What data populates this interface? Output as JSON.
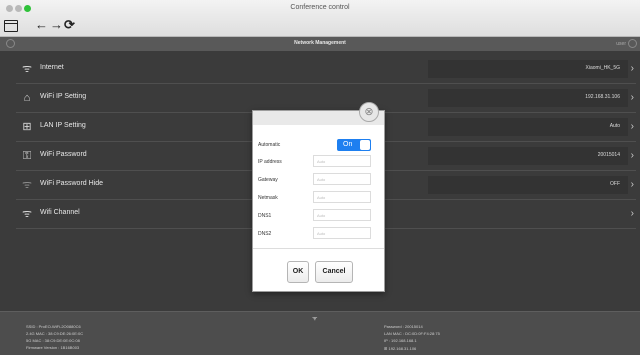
{
  "window": {
    "title": "Conference control"
  },
  "toolbar": {
    "window_icon": "window-icon",
    "back": "←",
    "forward": "→",
    "reload": "⟳"
  },
  "header": {
    "title": "Network Management",
    "user": "user"
  },
  "rows": [
    {
      "label": "Internet",
      "value": "Xiaomi_HK_5G",
      "icon": "wifi-icon",
      "glyph": "ᯤ"
    },
    {
      "label": "WiFi IP Setting",
      "value": "192.168.31.106",
      "icon": "router-icon",
      "glyph": "⌂"
    },
    {
      "label": "LAN IP Setting",
      "value": "Auto",
      "icon": "lan-icon",
      "glyph": "⊞"
    },
    {
      "label": "WiFi Password",
      "value": "20015014",
      "icon": "password-icon",
      "glyph": "⚿"
    },
    {
      "label": "WiFi Password Hide",
      "value": "OFF",
      "icon": "wifi-hide-icon",
      "glyph": "ᯤ"
    },
    {
      "label": "Wifi Channel",
      "value": "",
      "icon": "wifi-channel-icon",
      "glyph": "ᯤ"
    }
  ],
  "modal": {
    "automatic_label": "Automatic",
    "toggle_label": "On",
    "fields": [
      {
        "label": "IP address",
        "placeholder": "Auto"
      },
      {
        "label": "Gateway",
        "placeholder": "Auto"
      },
      {
        "label": "Netmask",
        "placeholder": "Auto"
      },
      {
        "label": "DNS1",
        "placeholder": "Auto"
      },
      {
        "label": "DNS2",
        "placeholder": "Auto"
      }
    ],
    "ok_label": "OK",
    "cancel_label": "Cancel"
  },
  "footer": {
    "left": [
      "SSID : ProEO-WiFi-2O0880C6",
      "2.4G MAC : 38:C9:DE:26:0E:0C",
      "5G MAC : 38:C9:DE:0E:0C:08",
      "Firmware Version : 1B16B003"
    ],
    "right": [
      "Password : 20015014",
      "LAN MAC : DC:0D:0F:F4:28:75",
      "IP : 192.168.168.1",
      "192.168.31.106"
    ]
  }
}
